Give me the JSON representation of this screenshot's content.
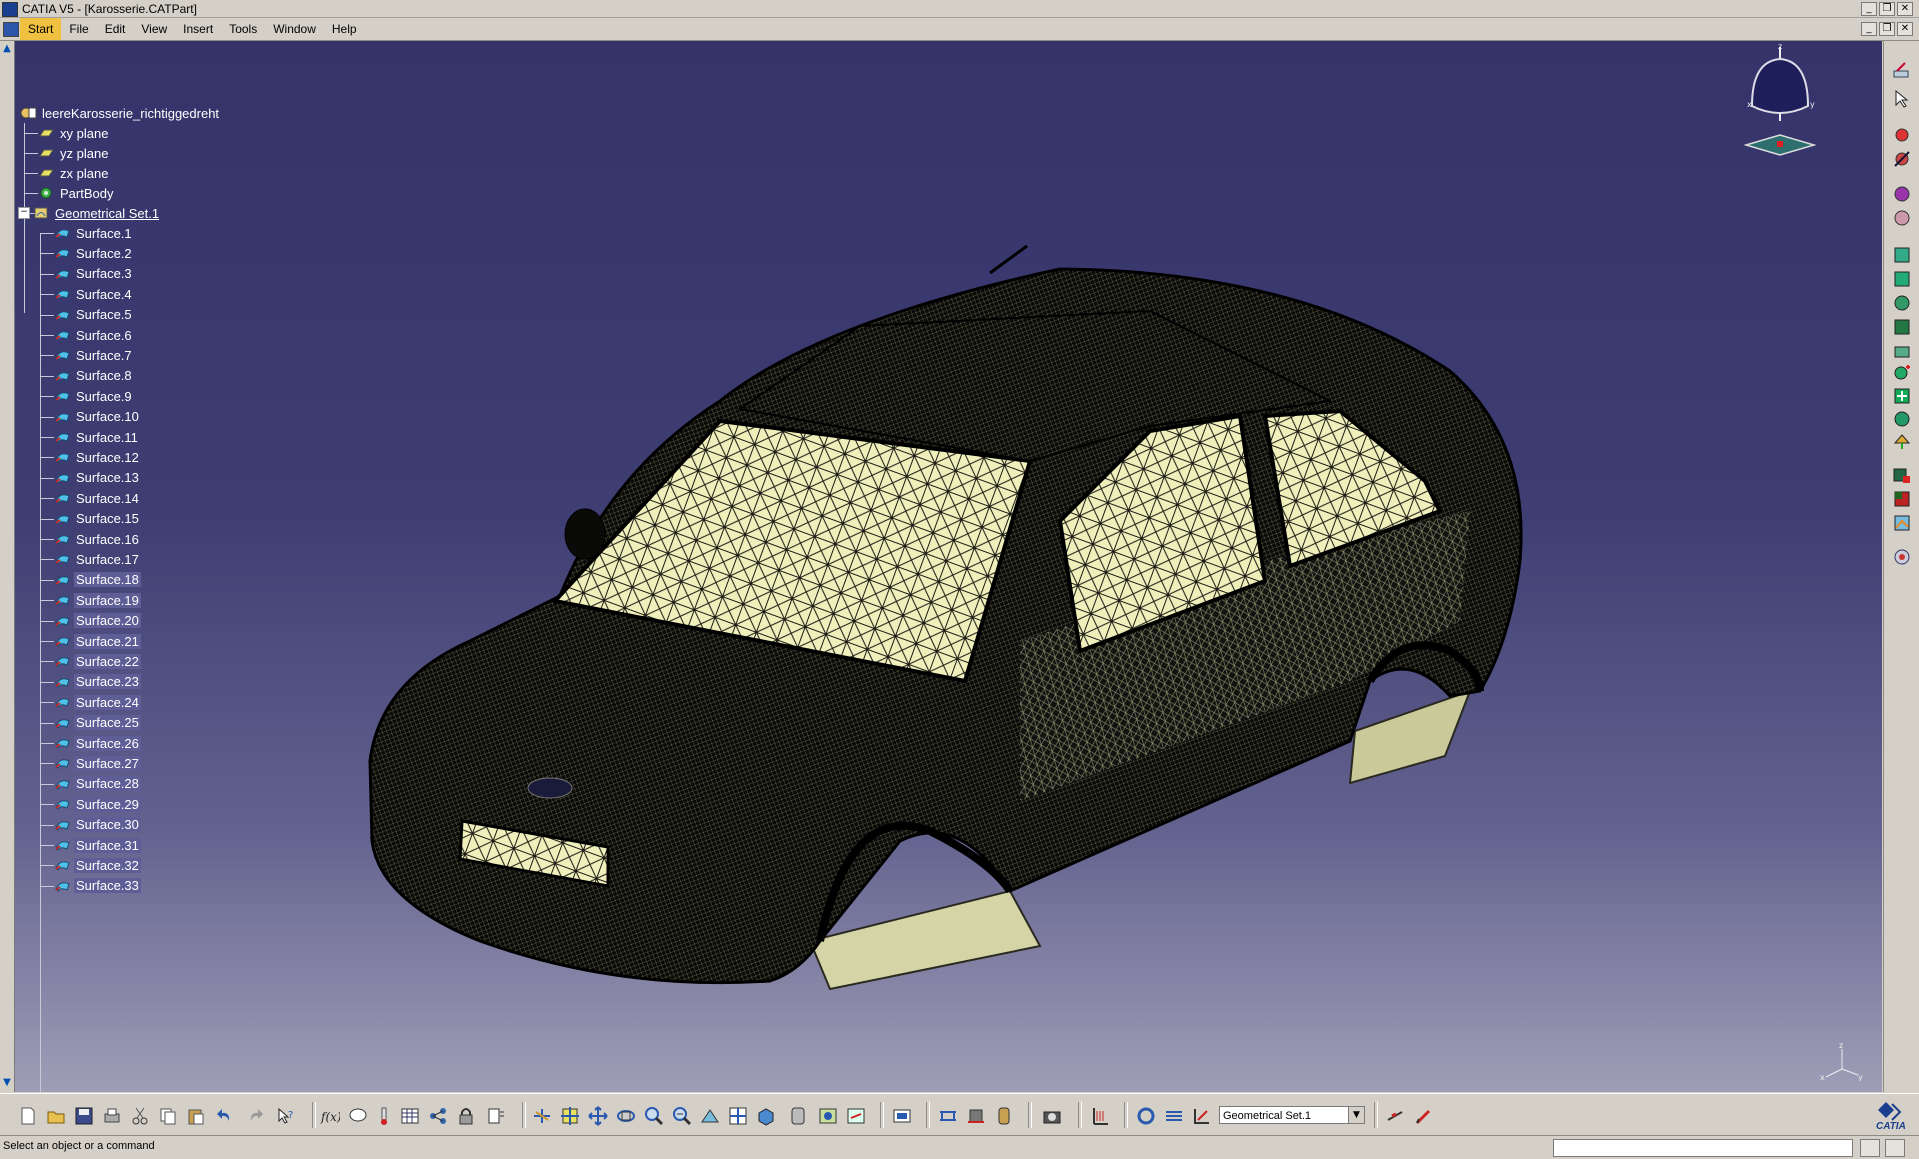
{
  "window": {
    "title": "CATIA V5 - [Karosserie.CATPart]",
    "controls": [
      "_",
      "❐",
      "✕"
    ]
  },
  "menubar": {
    "items": [
      "Start",
      "File",
      "Edit",
      "View",
      "Insert",
      "Tools",
      "Window",
      "Help"
    ],
    "active": "Start",
    "doc_controls": [
      "_",
      "❐",
      "✕"
    ]
  },
  "tree": {
    "root": "leereKarosserie_richtiggedreht",
    "planes": [
      "xy plane",
      "yz plane",
      "zx plane"
    ],
    "part_body": "PartBody",
    "geometrical_set": "Geometrical Set.1",
    "surfaces": [
      "Surface.1",
      "Surface.2",
      "Surface.3",
      "Surface.4",
      "Surface.5",
      "Surface.6",
      "Surface.7",
      "Surface.8",
      "Surface.9",
      "Surface.10",
      "Surface.11",
      "Surface.12",
      "Surface.13",
      "Surface.14",
      "Surface.15",
      "Surface.16",
      "Surface.17",
      "Surface.18",
      "Surface.19",
      "Surface.20",
      "Surface.21",
      "Surface.22",
      "Surface.23",
      "Surface.24",
      "Surface.25",
      "Surface.26",
      "Surface.27",
      "Surface.28",
      "Surface.29",
      "Surface.30",
      "Surface.31",
      "Surface.32",
      "Surface.33"
    ],
    "selected_from_index": 17
  },
  "viewer": {
    "model": "car-body-mesh",
    "compass_axes": [
      "z",
      "x",
      "y"
    ],
    "axis_labels": [
      "z",
      "x",
      "y"
    ]
  },
  "toolbar_bottom": {
    "current_set": "Geometrical Set.1"
  },
  "statusbar": {
    "message": "Select an object or a command"
  },
  "branding": {
    "logo_text": "CATIA"
  },
  "colors": {
    "viewport_top": "#35336a",
    "viewport_bottom": "#9f9db6",
    "mesh_fill": "#f2f2c0",
    "chrome": "#d4d0c8",
    "selection": "#5e5e97",
    "active_menu": "#f0c040"
  }
}
